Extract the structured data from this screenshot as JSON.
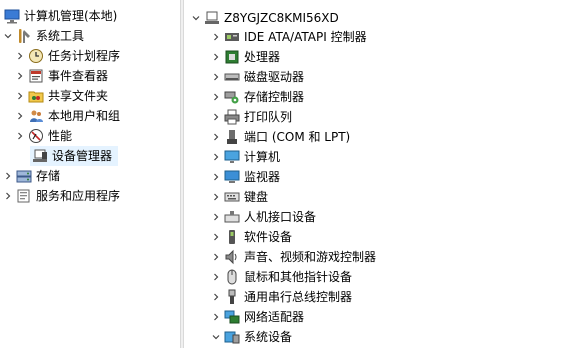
{
  "left_tree": {
    "root_label": "计算机管理(本地)",
    "items": [
      {
        "label": "系统工具",
        "icon": "tools-icon",
        "expanded": true
      },
      {
        "label": "任务计划程序",
        "icon": "clock-icon"
      },
      {
        "label": "事件查看器",
        "icon": "event-viewer-icon"
      },
      {
        "label": "共享文件夹",
        "icon": "shared-folder-icon"
      },
      {
        "label": "本地用户和组",
        "icon": "users-icon"
      },
      {
        "label": "性能",
        "icon": "performance-icon"
      },
      {
        "label": "设备管理器",
        "icon": "device-manager-icon",
        "selected": true
      },
      {
        "label": "存储",
        "icon": "storage-icon"
      },
      {
        "label": "服务和应用程序",
        "icon": "services-icon"
      }
    ]
  },
  "device_tree": {
    "computer_name": "Z8YGJZC8KMI56XD",
    "categories": [
      {
        "label": "IDE ATA/ATAPI 控制器",
        "icon": "ide-controller-icon"
      },
      {
        "label": "处理器",
        "icon": "processor-icon"
      },
      {
        "label": "磁盘驱动器",
        "icon": "disk-drive-icon"
      },
      {
        "label": "存储控制器",
        "icon": "storage-controller-icon"
      },
      {
        "label": "打印队列",
        "icon": "printer-icon"
      },
      {
        "label": "端口 (COM 和 LPT)",
        "icon": "port-icon"
      },
      {
        "label": "计算机",
        "icon": "computer-icon"
      },
      {
        "label": "监视器",
        "icon": "monitor-icon"
      },
      {
        "label": "键盘",
        "icon": "keyboard-icon"
      },
      {
        "label": "人机接口设备",
        "icon": "hid-icon"
      },
      {
        "label": "软件设备",
        "icon": "software-device-icon"
      },
      {
        "label": "声音、视频和游戏控制器",
        "icon": "speaker-icon"
      },
      {
        "label": "鼠标和其他指针设备",
        "icon": "mouse-icon"
      },
      {
        "label": "通用串行总线控制器",
        "icon": "usb-icon"
      },
      {
        "label": "网络适配器",
        "icon": "network-adapter-icon"
      },
      {
        "label": "系统设备",
        "icon": "system-device-icon",
        "expanded": true
      }
    ]
  },
  "colors": {
    "selection": "#e5f3ff",
    "splitter": "#f0f0f0"
  }
}
